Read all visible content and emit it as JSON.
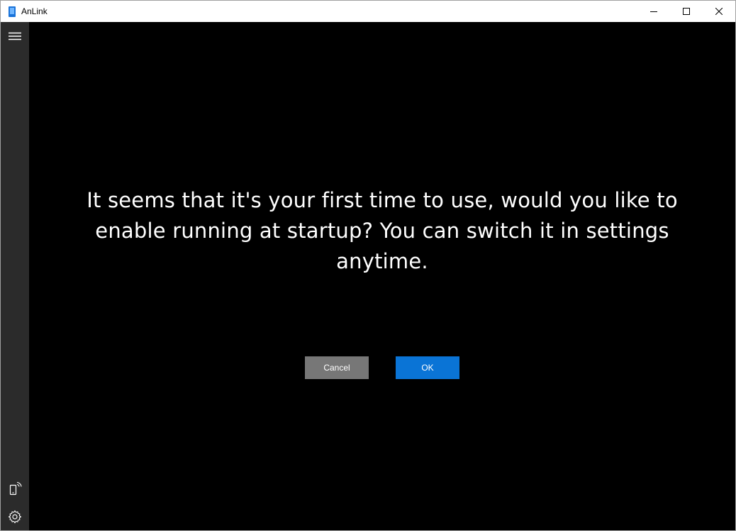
{
  "window": {
    "title": "AnLink"
  },
  "icons": {
    "app": "anlink-app-icon",
    "minimize": "minimize-icon",
    "maximize": "maximize-icon",
    "close": "close-icon",
    "menu": "hamburger-menu-icon",
    "device": "phone-connection-icon",
    "settings": "gear-icon"
  },
  "dialog": {
    "message": "It seems that it's your first time to use, would you like to enable running at startup? You can switch it in settings anytime.",
    "cancel_label": "Cancel",
    "ok_label": "OK"
  },
  "colors": {
    "background": "#000000",
    "sidebar": "#2b2b2b",
    "ok_button": "#0a74d6",
    "cancel_button": "#777777"
  }
}
